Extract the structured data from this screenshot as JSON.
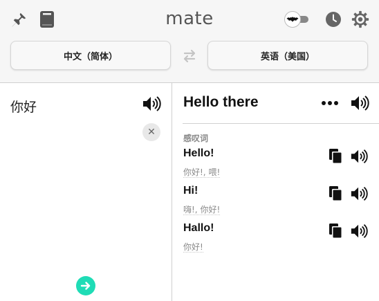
{
  "app": {
    "title": "mate"
  },
  "icons": {
    "pin": "pin-icon",
    "book": "book-icon",
    "toggle": "bat-toggle-icon",
    "history": "clock-icon",
    "settings": "gear-icon",
    "swap": "swap-icon",
    "speaker": "speaker-icon",
    "more": "more-dots-icon",
    "copy": "copy-icon",
    "clear": "close-icon",
    "go": "arrow-right-icon"
  },
  "languages": {
    "source": "中文（简体）",
    "target": "英语（美国）"
  },
  "source": {
    "text": "你好",
    "clear_label": "✕"
  },
  "result": {
    "main": "Hello there",
    "part_of_speech": "感叹词",
    "entries": [
      {
        "word": "Hello!",
        "translations": "你好!, 喂!"
      },
      {
        "word": "Hi!",
        "translations": "嗨!, 你好!"
      },
      {
        "word": "Hallo!",
        "translations": "你好!"
      }
    ]
  },
  "colors": {
    "accent": "#1fdcb6",
    "icon": "#555555",
    "header_bg": "#f6f6f6"
  }
}
